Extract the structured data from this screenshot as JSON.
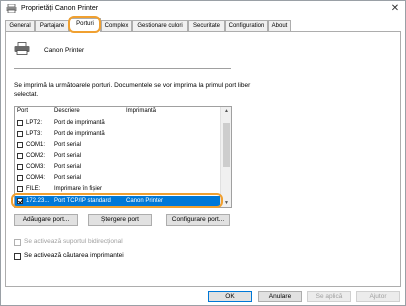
{
  "window": {
    "title": "Proprietăți Canon Printer",
    "close_glyph": "✕"
  },
  "tabs": [
    "General",
    "Partajare",
    "Porturi",
    "Complex",
    "Gestionare culori",
    "Securitate",
    "Configuration",
    "About"
  ],
  "active_tab": "Porturi",
  "printer": {
    "name": "Canon Printer"
  },
  "description": "Se imprimă la următoarele porturi. Documentele se vor imprima la primul port liber selectat.",
  "ports_table": {
    "headers": [
      "Port",
      "Descriere",
      "Imprimantă"
    ],
    "rows": [
      {
        "port": "LPT2:",
        "description": "Port de imprimantă",
        "printer": ""
      },
      {
        "port": "LPT3:",
        "description": "Port de imprimantă",
        "printer": ""
      },
      {
        "port": "COM1:",
        "description": "Port serial",
        "printer": ""
      },
      {
        "port": "COM2:",
        "description": "Port serial",
        "printer": ""
      },
      {
        "port": "COM3:",
        "description": "Port serial",
        "printer": ""
      },
      {
        "port": "COM4:",
        "description": "Port serial",
        "printer": ""
      },
      {
        "port": "FILE:",
        "description": "Imprimare în fișier",
        "printer": ""
      },
      {
        "port": "172.23...",
        "description": "Port TCP/IP standard",
        "printer": "Canon Printer"
      }
    ],
    "selected_index": 7
  },
  "buttons": {
    "add_port": "Adăugare port...",
    "delete_port": "Ștergere port",
    "configure_port": "Configurare port..."
  },
  "options": {
    "bidirectional": "Se activează suportul bidirecțional",
    "pooling": "Se activează căutarea imprimantei"
  },
  "footer": {
    "ok": "OK",
    "cancel": "Anulare",
    "apply": "Se aplică",
    "help": "Ajutor"
  },
  "colors": {
    "accent": "#0078d7",
    "highlight_ring": "#f0a030"
  }
}
